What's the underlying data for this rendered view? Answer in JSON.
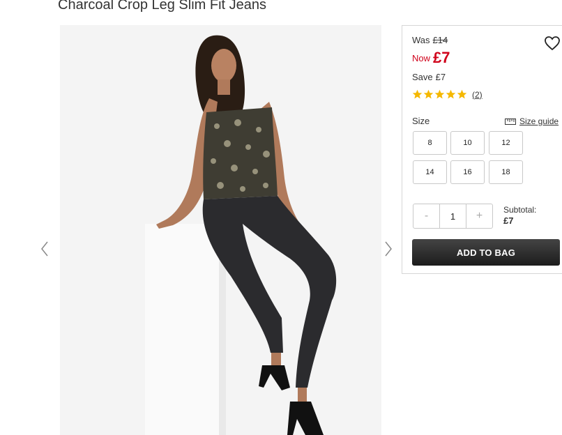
{
  "product": {
    "title": "Charcoal Crop Leg Slim Fit Jeans"
  },
  "gallery": {
    "prev_icon": "chevron-left-icon",
    "next_icon": "chevron-right-icon"
  },
  "pricing": {
    "was_label": "Was",
    "was_price": "£14",
    "now_label": "Now",
    "now_price": "£7",
    "save_label": "Save",
    "save_amount": "£7",
    "accent_color": "#d0021b"
  },
  "rating": {
    "stars": 5,
    "star_color": "#f5b800",
    "review_count": "(2)"
  },
  "size": {
    "label": "Size",
    "guide_label": "Size guide",
    "guide_icon": "ruler-icon",
    "options": [
      "8",
      "10",
      "12",
      "14",
      "16",
      "18"
    ]
  },
  "quantity": {
    "minus": "-",
    "value": "1",
    "plus": "+"
  },
  "subtotal": {
    "label": "Subtotal:",
    "amount": "£7"
  },
  "cart": {
    "add_label": "ADD TO BAG"
  },
  "wishlist": {
    "icon": "heart-icon"
  }
}
